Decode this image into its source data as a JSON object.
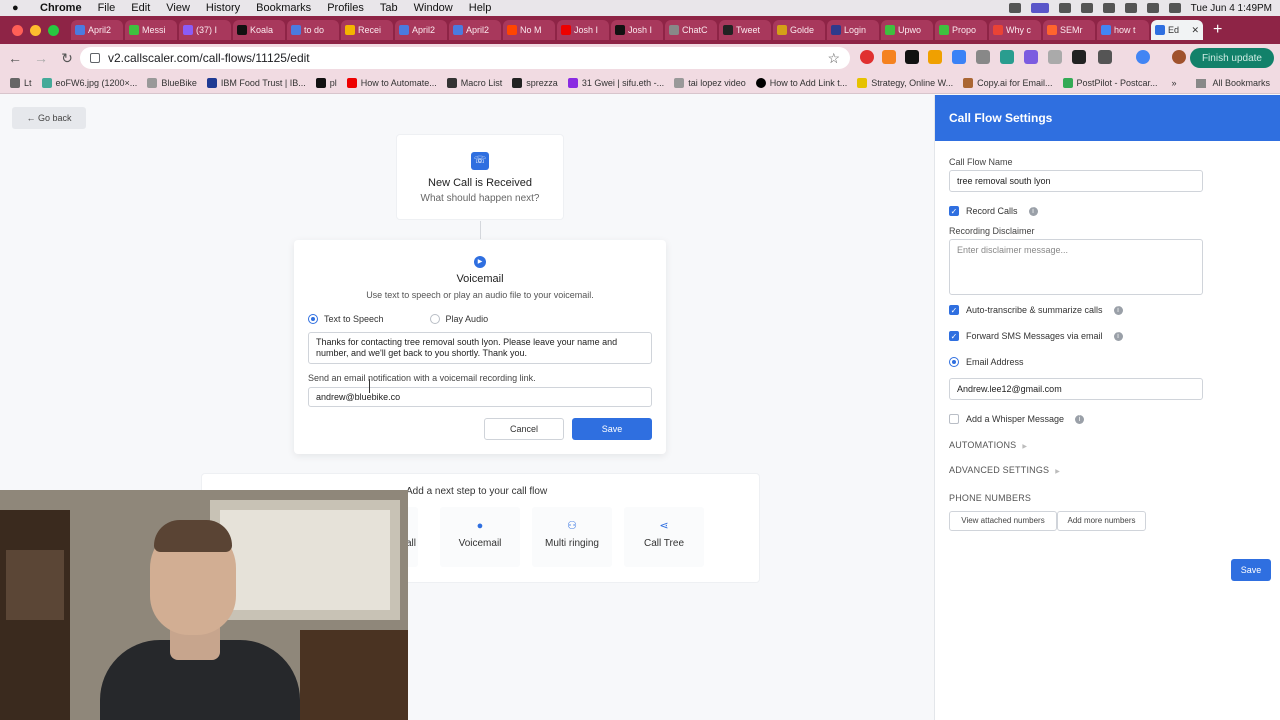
{
  "menubar": {
    "apple": "",
    "items": [
      "Chrome",
      "File",
      "Edit",
      "View",
      "History",
      "Bookmarks",
      "Profiles",
      "Tab",
      "Window",
      "Help"
    ],
    "clock": "Tue Jun 4  1:49PM"
  },
  "tabs": [
    {
      "label": "April2"
    },
    {
      "label": "Messi"
    },
    {
      "label": "(37) I"
    },
    {
      "label": "Koala"
    },
    {
      "label": "to do"
    },
    {
      "label": "Recei"
    },
    {
      "label": "April2"
    },
    {
      "label": "April2"
    },
    {
      "label": "No M"
    },
    {
      "label": "Josh I"
    },
    {
      "label": "Josh I"
    },
    {
      "label": "ChatC"
    },
    {
      "label": "Tweet"
    },
    {
      "label": "Golde"
    },
    {
      "label": "Login"
    },
    {
      "label": "Upwo"
    },
    {
      "label": "Propo"
    },
    {
      "label": "Why c"
    },
    {
      "label": "SEMr"
    },
    {
      "label": "how t"
    },
    {
      "label": "Ed"
    }
  ],
  "toolbar": {
    "url": "v2.callscaler.com/call-flows/11125/edit",
    "finish_update": "Finish update"
  },
  "bookmarks": [
    {
      "label": "Lt"
    },
    {
      "label": "eoFW6.jpg (1200×..."
    },
    {
      "label": "BlueBike"
    },
    {
      "label": "IBM Food Trust | IB..."
    },
    {
      "label": "pl"
    },
    {
      "label": "How to Automate..."
    },
    {
      "label": "Macro List"
    },
    {
      "label": "sprezza"
    },
    {
      "label": "31 Gwei | sifu.eth -..."
    },
    {
      "label": "tai lopez video"
    },
    {
      "label": "How to Add Link t..."
    },
    {
      "label": "Strategy, Online W..."
    },
    {
      "label": "Copy.ai for Email..."
    },
    {
      "label": "PostPilot - Postcar..."
    }
  ],
  "bookmarks_more": "»",
  "all_bookmarks": "All Bookmarks",
  "page": {
    "go_back": "← Go back",
    "trigger": {
      "title": "New Call is Received",
      "subtitle": "What should happen next?"
    },
    "voicemail": {
      "title": "Voicemail",
      "description": "Use text to speech or play an audio file to your voicemail.",
      "option_tts": "Text to Speech",
      "option_audio": "Play Audio",
      "message": "Thanks for contacting tree removal south lyon. Please leave your name and number, and we'll get back to you shortly. Thank you.",
      "email_label": "Send an email notification with a voicemail recording link.",
      "email_value": "andrew@bluebike.co",
      "cancel": "Cancel",
      "save": "Save"
    },
    "next_step": {
      "title": "Add a next step to your call flow",
      "options": [
        {
          "label": "all",
          "icon": "forward-call-icon"
        },
        {
          "label": "Voicemail",
          "icon": "voicemail-icon"
        },
        {
          "label": "Multi ringing",
          "icon": "people-icon"
        },
        {
          "label": "Call Tree",
          "icon": "share-tree-icon"
        }
      ]
    }
  },
  "sidebar": {
    "title": "Call Flow Settings",
    "name_label": "Call Flow Name",
    "name_value": "tree removal south lyon",
    "record_calls": "Record Calls",
    "disclaimer_label": "Recording Disclaimer",
    "disclaimer_placeholder": "Enter disclaimer message...",
    "auto_transcribe": "Auto-transcribe & summarize calls",
    "forward_sms": "Forward SMS Messages via email",
    "email_address_label": "Email Address",
    "email_address_value": "Andrew.lee12@gmail.com",
    "whisper": "Add a Whisper Message",
    "automations": "AUTOMATIONS",
    "advanced": "ADVANCED SETTINGS",
    "phone_numbers": "PHONE NUMBERS",
    "view_attached": "View attached numbers",
    "add_more": "Add more numbers",
    "save": "Save"
  },
  "colors": {
    "accent": "#2f6fe0",
    "tabstrip": "#8e2446"
  }
}
